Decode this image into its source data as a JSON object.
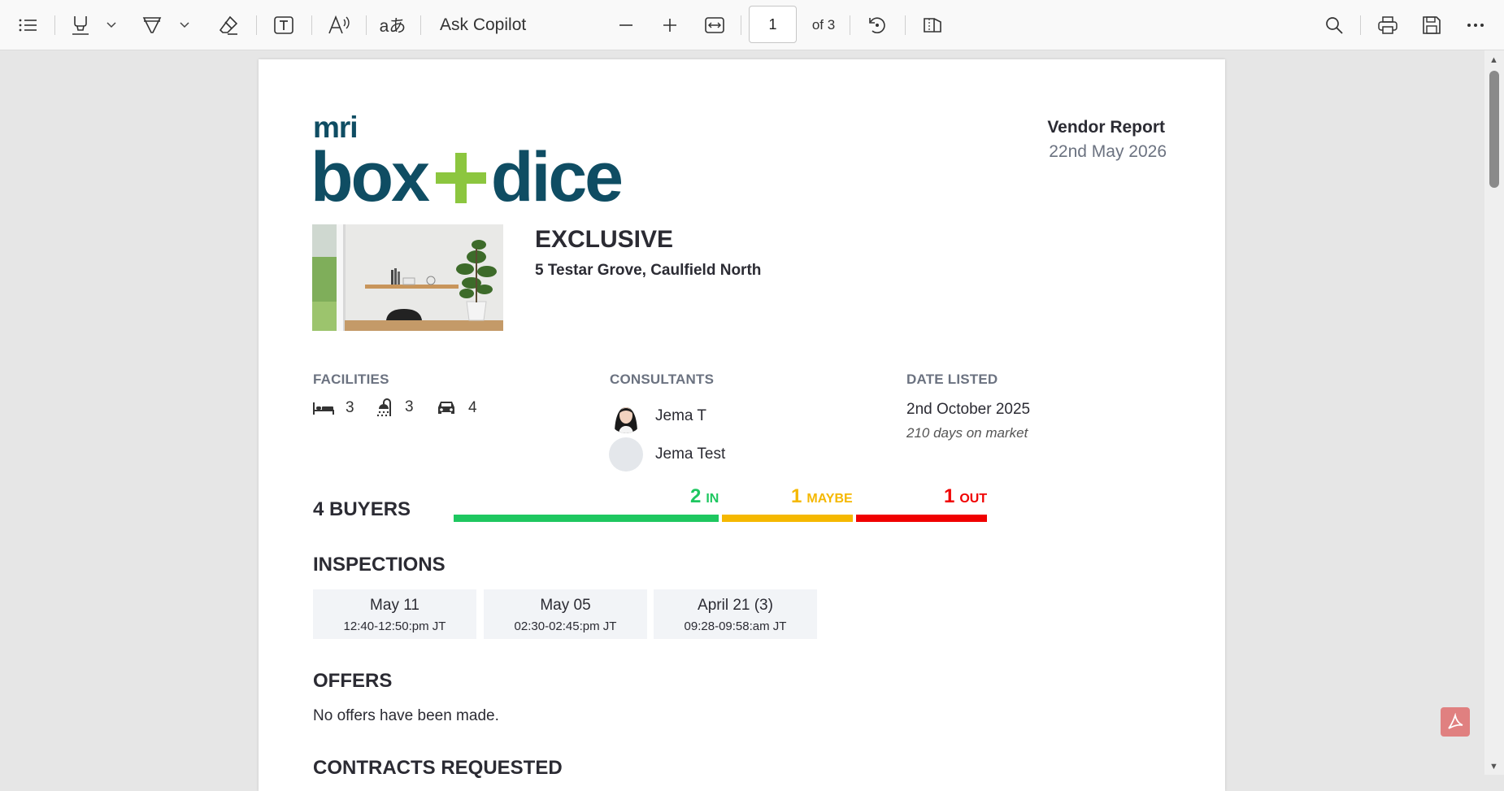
{
  "toolbar": {
    "ask_copilot": "Ask Copilot",
    "page_current": "1",
    "page_of": "of 3",
    "icons": [
      "contents-icon",
      "highlight-icon",
      "chevron-down-icon",
      "draw-icon",
      "chevron-down-icon",
      "erase-icon",
      "text-box-icon",
      "read-aloud-icon",
      "translate-icon",
      "zoom-out-icon",
      "zoom-in-icon",
      "fit-width-icon",
      "rotate-icon",
      "page-view-icon",
      "search-icon",
      "print-icon",
      "save-icon",
      "more-icon"
    ]
  },
  "report": {
    "logo_small": "mri",
    "logo_word1": "box",
    "logo_word2": "dice",
    "title": "Vendor Report",
    "date": "22nd May 2026",
    "status": "EXCLUSIVE",
    "address": "5 Testar Grove, Caulfield North"
  },
  "facilities": {
    "label": "FACILITIES",
    "bed": "3",
    "bath": "3",
    "car": "4"
  },
  "consultants": {
    "label": "CONSULTANTS",
    "items": [
      "Jema T",
      "Jema Test"
    ]
  },
  "date_listed": {
    "label": "DATE LISTED",
    "date": "2nd October 2025",
    "days": "210 days on market"
  },
  "buyers": {
    "title": "4 BUYERS",
    "in_count": "2",
    "in_label": "IN",
    "maybe_count": "1",
    "maybe_label": "MAYBE",
    "out_count": "1",
    "out_label": "OUT",
    "in_share": 0.5,
    "maybe_share": 0.25,
    "out_share": 0.25,
    "colors": {
      "in": "#1ec760",
      "maybe": "#f5b800",
      "out": "#f00000"
    }
  },
  "inspections": {
    "title": "INSPECTIONS",
    "items": [
      {
        "date": "May 11",
        "time": "12:40-12:50:pm JT"
      },
      {
        "date": "May 05",
        "time": "02:30-02:45:pm JT"
      },
      {
        "date": "April 21 (3)",
        "time": "09:28-09:58:am JT"
      }
    ]
  },
  "offers": {
    "title": "OFFERS",
    "text": "No offers have been made."
  },
  "contracts": {
    "title": "CONTRACTS REQUESTED"
  }
}
